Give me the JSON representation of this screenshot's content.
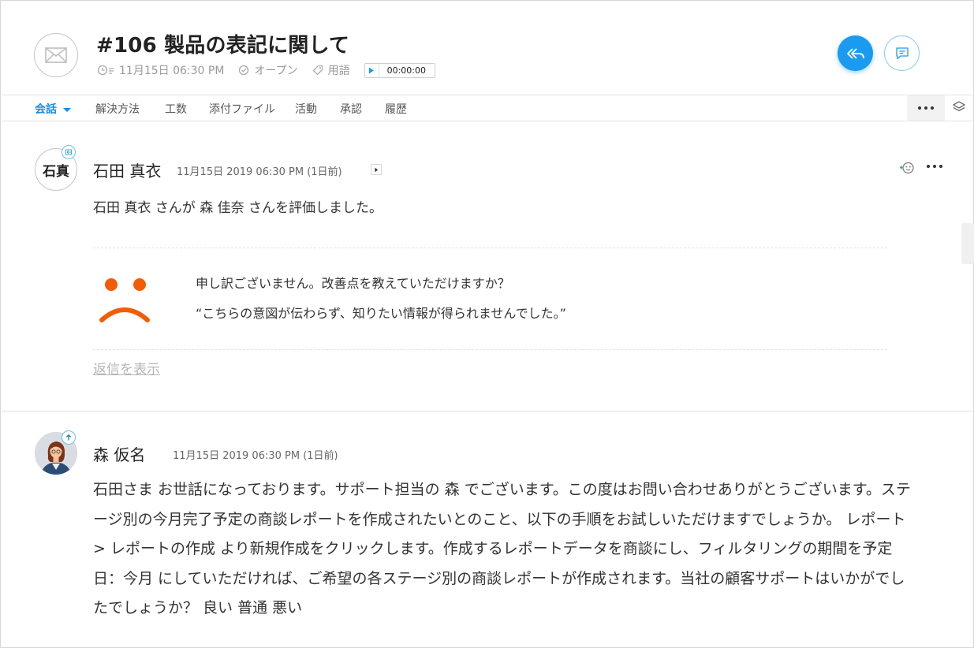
{
  "ticket": {
    "title": "#106 製品の表記に関して",
    "created": "11月15日 06:30 PM",
    "status": "オープン",
    "tag": "用語",
    "timer": "00:00:00"
  },
  "tabs": [
    {
      "label": "会話",
      "active": true
    },
    {
      "label": "解決方法"
    },
    {
      "label": "工数"
    },
    {
      "label": "添付ファイル"
    },
    {
      "label": "活動"
    },
    {
      "label": "承認"
    },
    {
      "label": "履歴"
    }
  ],
  "thread1": {
    "avatar_initials": "石真",
    "author": "石田 真衣",
    "timestamp": "11月15日 2019 06:30 PM (1日前)",
    "text": "石田 真衣 さんが 森 佳奈 さんを評価しました。",
    "rating": {
      "line1": "申し訳ございません。改善点を教えていただけますか？",
      "line2": "“こちらの意図が伝わらず、知りたい情報が得られませんでした。”"
    },
    "show_replies": "返信を表示"
  },
  "thread2": {
    "author": "森 仮名",
    "timestamp": "11月15日 2019 06:30 PM (1日前)",
    "text": "石田さま お世話になっております。サポート担当の 森 でございます。この度はお問い合わせありがとうございます。ステージ別の今月完了予定の商談レポートを作成されたいとのこと、以下の手順をお試しいただけますでしょうか。 レポート > レポートの作成 より新規作成をクリックします。作成するレポートデータを商談にし、フィルタリングの期間を予定日：今月 にしていただければ、ご希望の各ステージ別の商談レポートが作成されます。当社の顧客サポートはいかがでしたでしょうか？ 良い 普通 悪い"
  },
  "colors": {
    "accent": "#1a9bf0",
    "tab_active": "#1a8be0",
    "sad_face": "#f25c05",
    "muted": "#9a9a9a"
  },
  "icons": [
    "envelope-icon",
    "clock-icon",
    "status-check-icon",
    "tag-icon",
    "play-icon",
    "reply-all-icon",
    "comment-icon",
    "more-icon",
    "layers-icon",
    "emoji-icon",
    "sad-face-icon",
    "incoming-badge-icon",
    "outgoing-badge-icon"
  ]
}
